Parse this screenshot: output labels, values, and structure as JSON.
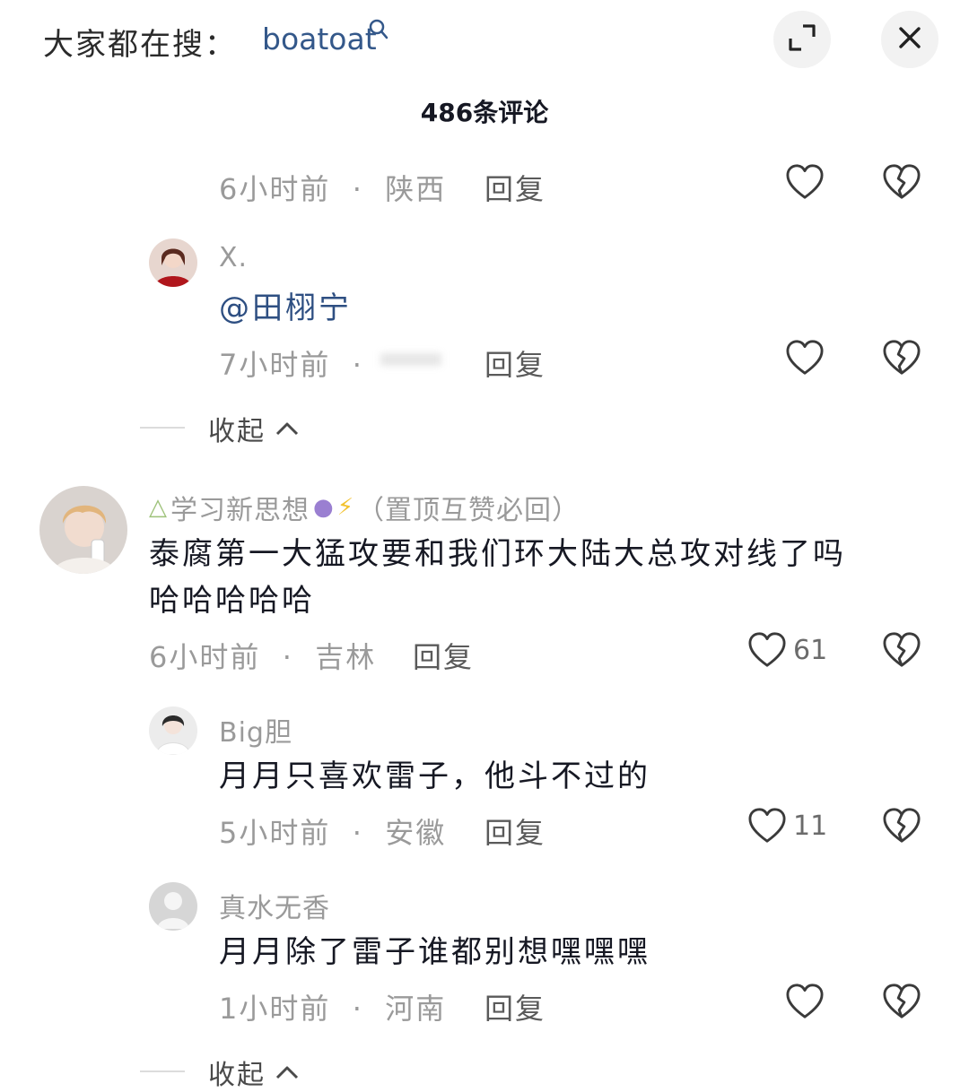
{
  "header": {
    "search_prefix": "大家都在搜：",
    "search_term": "boatoat",
    "comment_count": "486条评论"
  },
  "icons": {
    "search": "magnifier-icon",
    "expand": "expand-icon",
    "close": "close-icon",
    "like": "heart-outline-icon",
    "dislike": "broken-heart-icon"
  },
  "comments": {
    "c0": {
      "time": "6小时前",
      "location": "陕西",
      "reply": "回复"
    },
    "c1": {
      "username": "X.",
      "content": "@田栩宁",
      "time": "7小时前",
      "location": "",
      "reply": "回复"
    },
    "collapse1": "收起",
    "c2": {
      "username": "学习新思想",
      "username_suffix": "（置顶互赞必回）",
      "content_line1": "泰腐第一大猛攻要和我们环大陆大总攻对线了吗",
      "content_line2": "哈哈哈哈哈",
      "time": "6小时前",
      "location": "吉林",
      "reply": "回复",
      "likes": "61"
    },
    "c3": {
      "username": "Big胆",
      "content": "月月只喜欢雷子，他斗不过的",
      "time": "5小时前",
      "location": "安徽",
      "reply": "回复",
      "likes": "11"
    },
    "c4": {
      "username": "真水无香",
      "content": "月月除了雷子谁都别想嘿嘿嘿",
      "time": "1小时前",
      "location": "河南",
      "reply": "回复"
    },
    "collapse2": "收起"
  },
  "colors": {
    "mention": "#2e4f82",
    "search_term": "#34588a",
    "muted": "#9a9a9a",
    "text": "#161823"
  }
}
